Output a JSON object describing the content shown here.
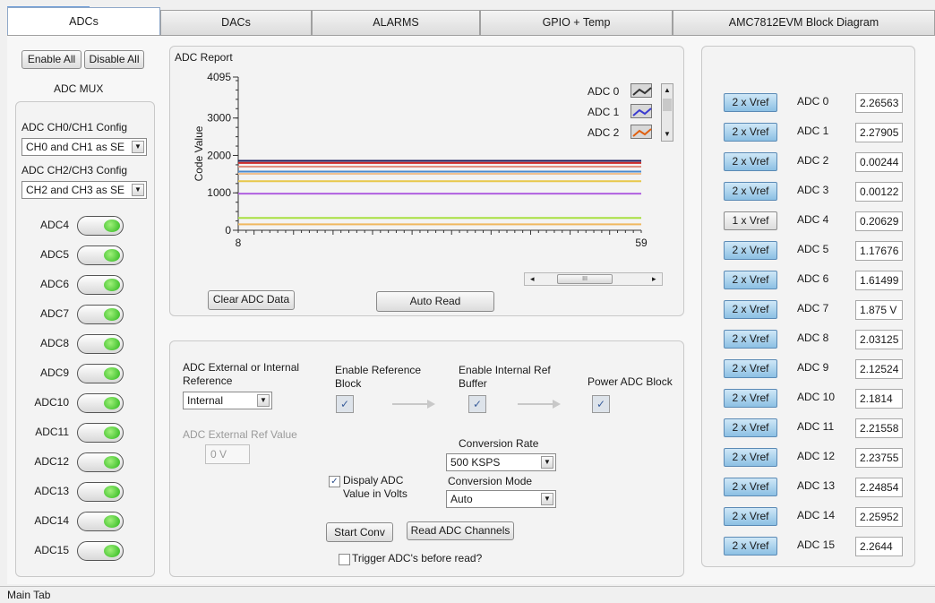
{
  "tabs": [
    {
      "label": "ADCs"
    },
    {
      "label": "DACs"
    },
    {
      "label": "ALARMS"
    },
    {
      "label": "GPIO + Temp"
    },
    {
      "label": "AMC7812EVM Block Diagram"
    }
  ],
  "left": {
    "enable_all": "Enable All",
    "disable_all": "Disable All",
    "mux_title": "ADC MUX",
    "ch01_label": "ADC CH0/CH1 Config",
    "ch01_value": "CH0 and CH1 as SE",
    "ch23_label": "ADC CH2/CH3 Config",
    "ch23_value": "CH2 and CH3 as SE",
    "leds": [
      {
        "label": "ADC4",
        "on": true
      },
      {
        "label": "ADC5",
        "on": true
      },
      {
        "label": "ADC6",
        "on": true
      },
      {
        "label": "ADC7",
        "on": true
      },
      {
        "label": "ADC8",
        "on": true
      },
      {
        "label": "ADC9",
        "on": true
      },
      {
        "label": "ADC10",
        "on": true
      },
      {
        "label": "ADC11",
        "on": true
      },
      {
        "label": "ADC12",
        "on": true
      },
      {
        "label": "ADC13",
        "on": true
      },
      {
        "label": "ADC14",
        "on": true
      },
      {
        "label": "ADC15",
        "on": true
      }
    ]
  },
  "report": {
    "title": "ADC Report",
    "clear_button": "Clear ADC Data",
    "auto_read_button": "Auto Read",
    "legend": [
      {
        "label": "ADC 0",
        "color": "#333333"
      },
      {
        "label": "ADC 1",
        "color": "#3b3bd0"
      },
      {
        "label": "ADC 2",
        "color": "#e06010"
      }
    ],
    "scroll_thumb": "III"
  },
  "chart_data": {
    "type": "line",
    "title": "",
    "ylabel": "Code Value",
    "xlabel": "",
    "xlim": [
      8,
      59
    ],
    "ylim": [
      0,
      4095
    ],
    "yticks": [
      0,
      1000,
      2000,
      3000,
      4095
    ],
    "xticks": [
      8,
      59
    ],
    "series": [
      {
        "color": "#1a1a5a",
        "values": [
          1855,
          1855
        ]
      },
      {
        "color": "#cc2a2a",
        "values": [
          1800,
          1800
        ]
      },
      {
        "color": "#e09080",
        "values": [
          1700,
          1700
        ]
      },
      {
        "color": "#4a8ad0",
        "values": [
          1570,
          1570
        ]
      },
      {
        "color": "#f0c090",
        "values": [
          1510,
          1510
        ]
      },
      {
        "color": "#e8c84a",
        "values": [
          1310,
          1310
        ]
      },
      {
        "color": "#b060e0",
        "values": [
          980,
          980
        ]
      },
      {
        "color": "#a8e040",
        "values": [
          330,
          330
        ]
      },
      {
        "color": "#f0b860",
        "values": [
          160,
          160
        ]
      }
    ]
  },
  "config": {
    "ref_label": "ADC External or Internal Reference",
    "ref_value": "Internal",
    "ext_ref_label": "ADC External Ref Value",
    "ext_ref_value": "0 V",
    "enable_ref_block": "Enable Reference Block",
    "enable_int_ref_buffer": "Enable Internal Ref Buffer",
    "power_adc_block": "Power ADC Block",
    "check_mark": "✓",
    "conv_rate_label": "Conversion Rate",
    "conv_rate_value": "500 KSPS",
    "conv_mode_label": "Conversion Mode",
    "conv_mode_value": "Auto",
    "display_volts_label": "Dispaly ADC Value in Volts",
    "start_conv": "Start Conv",
    "read_channels": "Read ADC Channels",
    "trigger_label": "Trigger ADC's before read?"
  },
  "right": {
    "rows": [
      {
        "vref": "2 x Vref",
        "active": true,
        "label": "ADC 0",
        "value": "2.26563"
      },
      {
        "vref": "2 x Vref",
        "active": true,
        "label": "ADC 1",
        "value": "2.27905"
      },
      {
        "vref": "2 x Vref",
        "active": true,
        "label": "ADC 2",
        "value": "0.00244"
      },
      {
        "vref": "2 x Vref",
        "active": true,
        "label": "ADC 3",
        "value": "0.00122"
      },
      {
        "vref": "1 x Vref",
        "active": false,
        "label": "ADC 4",
        "value": "0.20629"
      },
      {
        "vref": "2 x Vref",
        "active": true,
        "label": "ADC 5",
        "value": "1.17676"
      },
      {
        "vref": "2 x Vref",
        "active": true,
        "label": "ADC 6",
        "value": "1.61499"
      },
      {
        "vref": "2 x Vref",
        "active": true,
        "label": "ADC 7",
        "value": "1.875 V"
      },
      {
        "vref": "2 x Vref",
        "active": true,
        "label": "ADC 8",
        "value": "2.03125"
      },
      {
        "vref": "2 x Vref",
        "active": true,
        "label": "ADC 9",
        "value": "2.12524"
      },
      {
        "vref": "2 x Vref",
        "active": true,
        "label": "ADC 10",
        "value": "2.1814"
      },
      {
        "vref": "2 x Vref",
        "active": true,
        "label": "ADC 11",
        "value": "2.21558"
      },
      {
        "vref": "2 x Vref",
        "active": true,
        "label": "ADC 12",
        "value": "2.23755"
      },
      {
        "vref": "2 x Vref",
        "active": true,
        "label": "ADC 13",
        "value": "2.24854"
      },
      {
        "vref": "2 x Vref",
        "active": true,
        "label": "ADC 14",
        "value": "2.25952"
      },
      {
        "vref": "2 x Vref",
        "active": true,
        "label": "ADC 15",
        "value": "2.2644"
      }
    ]
  },
  "status": {
    "text": "Main Tab"
  }
}
